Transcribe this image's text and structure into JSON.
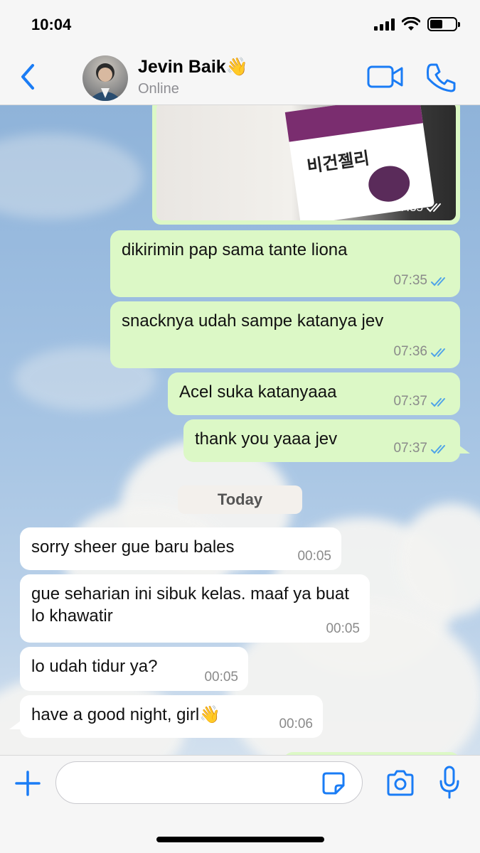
{
  "status_bar": {
    "time": "10:04"
  },
  "header": {
    "contact_name": "Jevin Baik👋",
    "contact_status": "Online"
  },
  "photo_message": {
    "time": "07:35"
  },
  "messages": [
    {
      "direction": "out",
      "text": "dikirimin pap sama tante liona",
      "time": "07:35",
      "read": true
    },
    {
      "direction": "out",
      "text": "snacknya udah sampe katanya jev",
      "time": "07:36",
      "read": true
    },
    {
      "direction": "out",
      "text": "Acel suka katanyaaa",
      "time": "07:37",
      "read": true
    },
    {
      "direction": "out",
      "text": "thank you yaaa jev",
      "time": "07:37",
      "read": true
    },
    {
      "direction": "in",
      "text": "sorry sheer gue baru bales",
      "time": "00:05"
    },
    {
      "direction": "in",
      "text": "gue seharian ini sibuk kelas. maaf ya buat lo khawatir",
      "time": "00:05"
    },
    {
      "direction": "in",
      "text": "lo udah tidur ya?",
      "time": "00:05"
    },
    {
      "direction": "in",
      "text": "have a good night, girl👋",
      "time": "00:06"
    }
  ],
  "date_divider": "Today",
  "input": {
    "placeholder": ""
  },
  "colors": {
    "accent": "#1a7cf5",
    "outgoing_bubble": "#dcf8c6",
    "incoming_bubble": "#ffffff",
    "read_ticks": "#4fa3e8"
  },
  "icons": {
    "back": "chevron-left-icon",
    "video": "video-camera-icon",
    "call": "phone-icon",
    "add": "plus-icon",
    "sticker": "sticker-icon",
    "camera": "camera-icon",
    "mic": "microphone-icon"
  }
}
